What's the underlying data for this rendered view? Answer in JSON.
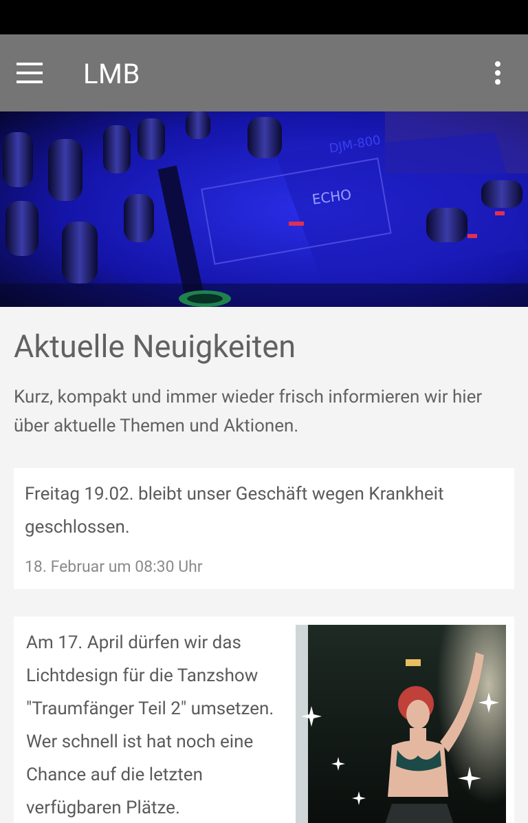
{
  "app_bar": {
    "title": "LMB",
    "menu_icon": "hamburger-menu-icon",
    "overflow_icon": "more-vert-icon",
    "background": "#757575"
  },
  "hero": {
    "alt": "DJ mixer with blue lighting",
    "mixer_labels": [
      "ECHO",
      "DJM-800"
    ]
  },
  "main": {
    "title": "Aktuelle Neuigkeiten",
    "intro": "Kurz, kompakt und immer wieder frisch informieren wir hier über aktuelle Themen und Aktionen."
  },
  "news": [
    {
      "text": "Freitag 19.02. bleibt unser Geschäft wegen Krankheit geschlossen.",
      "timestamp": "18. Februar um 08:30 Uhr"
    },
    {
      "text": "Am 17. April dürfen wir das Lichtdesign für die Tanzshow \"Traumfänger Teil 2\" umsetzen. Wer schnell ist hat noch eine Chance auf die letzten verfügbaren Plätze.",
      "image_alt": "Belly dancer on stage with sparkling lights"
    }
  ]
}
